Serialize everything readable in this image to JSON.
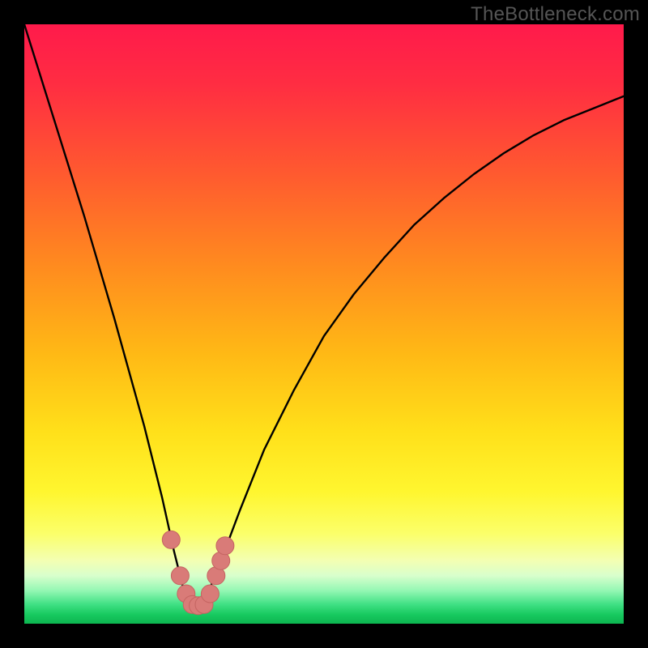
{
  "watermark": "TheBottleneck.com",
  "colors": {
    "frame": "#000000",
    "curve": "#000000",
    "marker_fill": "#d97b78",
    "marker_stroke": "#c46461",
    "gradient_stops": [
      {
        "offset": 0.0,
        "color": "#ff1a4b"
      },
      {
        "offset": 0.1,
        "color": "#ff2d42"
      },
      {
        "offset": 0.25,
        "color": "#ff5a2f"
      },
      {
        "offset": 0.4,
        "color": "#ff8a1f"
      },
      {
        "offset": 0.55,
        "color": "#ffb915"
      },
      {
        "offset": 0.68,
        "color": "#ffe01a"
      },
      {
        "offset": 0.78,
        "color": "#fff62f"
      },
      {
        "offset": 0.85,
        "color": "#fbff6a"
      },
      {
        "offset": 0.895,
        "color": "#f3ffb3"
      },
      {
        "offset": 0.92,
        "color": "#d8ffcc"
      },
      {
        "offset": 0.945,
        "color": "#93f7b3"
      },
      {
        "offset": 0.968,
        "color": "#3fe083"
      },
      {
        "offset": 0.985,
        "color": "#17c95f"
      },
      {
        "offset": 1.0,
        "color": "#0db550"
      }
    ]
  },
  "chart_data": {
    "type": "line",
    "title": "",
    "xlabel": "",
    "ylabel": "",
    "xlim": [
      0,
      100
    ],
    "ylim": [
      0,
      100
    ],
    "minimum_x": 28,
    "series": [
      {
        "name": "bottleneck-curve",
        "x": [
          0,
          5,
          10,
          15,
          20,
          23,
          25,
          26.5,
          28,
          29.5,
          31,
          33,
          36,
          40,
          45,
          50,
          55,
          60,
          65,
          70,
          75,
          80,
          85,
          90,
          95,
          100
        ],
        "values": [
          100,
          84,
          68,
          51,
          33,
          21,
          12,
          6,
          3,
          3,
          6,
          11,
          19,
          29,
          39,
          48,
          55,
          61,
          66.5,
          71,
          75,
          78.5,
          81.5,
          84,
          86,
          88
        ]
      }
    ],
    "markers": {
      "name": "highlight-points",
      "x": [
        24.5,
        26,
        27,
        28,
        29,
        30,
        31,
        32,
        32.8,
        33.5
      ],
      "values": [
        14,
        8,
        5,
        3.2,
        3.0,
        3.2,
        5,
        8,
        10.5,
        13
      ]
    }
  }
}
